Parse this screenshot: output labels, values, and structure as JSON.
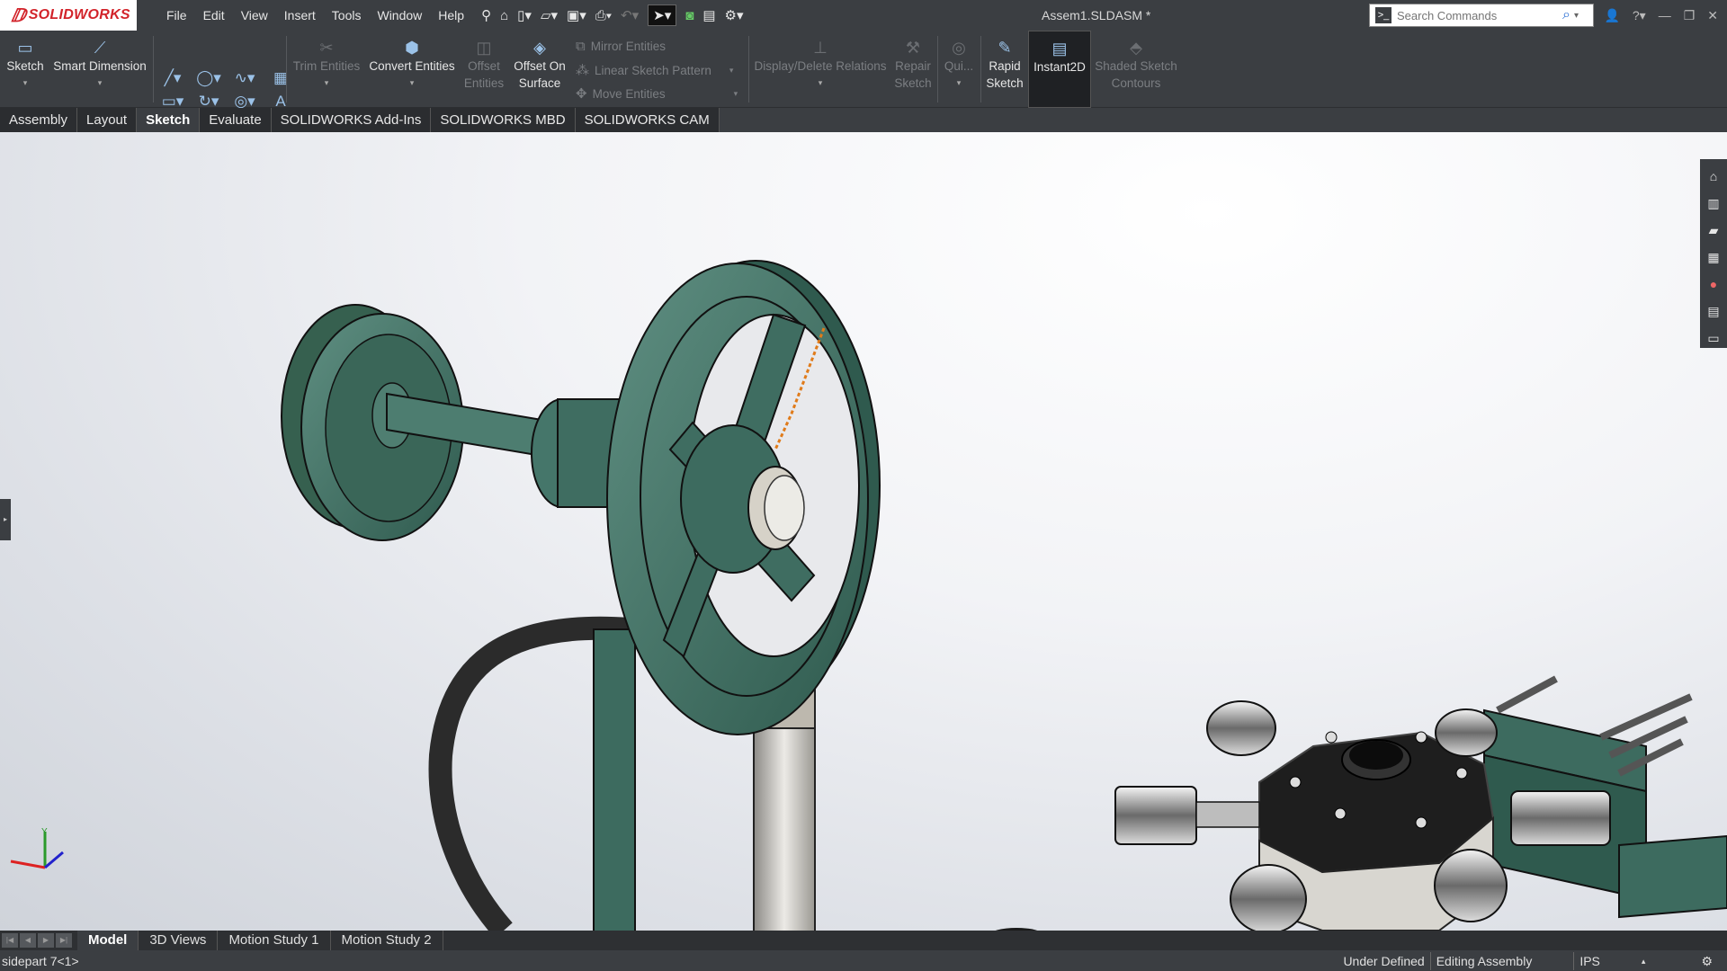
{
  "app": {
    "brand": "SOLIDWORKS",
    "doc_title": "Assem1.SLDASM *"
  },
  "menu": [
    "File",
    "Edit",
    "View",
    "Insert",
    "Tools",
    "Window",
    "Help"
  ],
  "search": {
    "placeholder": "Search Commands"
  },
  "commands": {
    "sketch": "Sketch",
    "smart_dimension": "Smart Dimension",
    "trim_entities": "Trim Entities",
    "convert_entities": "Convert Entities",
    "offset_entities_1": "Offset",
    "offset_entities_2": "Entities",
    "offset_on_surface_1": "Offset On",
    "offset_on_surface_2": "Surface",
    "mirror_entities": "Mirror Entities",
    "linear_sketch_pattern": "Linear Sketch Pattern",
    "move_entities": "Move Entities",
    "display_delete_relations": "Display/Delete Relations",
    "repair_sketch_1": "Repair",
    "repair_sketch_2": "Sketch",
    "quick_snaps": "Qui...",
    "rapid_sketch_1": "Rapid",
    "rapid_sketch_2": "Sketch",
    "instant2d": "Instant2D",
    "shaded_sketch_1": "Shaded Sketch",
    "shaded_sketch_2": "Contours"
  },
  "tabs": [
    "Assembly",
    "Layout",
    "Sketch",
    "Evaluate",
    "SOLIDWORKS Add-Ins",
    "SOLIDWORKS MBD",
    "SOLIDWORKS CAM"
  ],
  "active_tab": "Sketch",
  "bottom_tabs": [
    "Model",
    "3D Views",
    "Motion Study 1",
    "Motion Study 2"
  ],
  "status": {
    "selection": "sidepart 7<1>",
    "definition": "Under Defined",
    "mode": "Editing Assembly",
    "units": "IPS"
  },
  "colors": {
    "chrome": "#3b3e42",
    "part_green": "#3d6b5f",
    "brand_red": "#d2232a",
    "sketch_orange": "#e07b1a"
  }
}
